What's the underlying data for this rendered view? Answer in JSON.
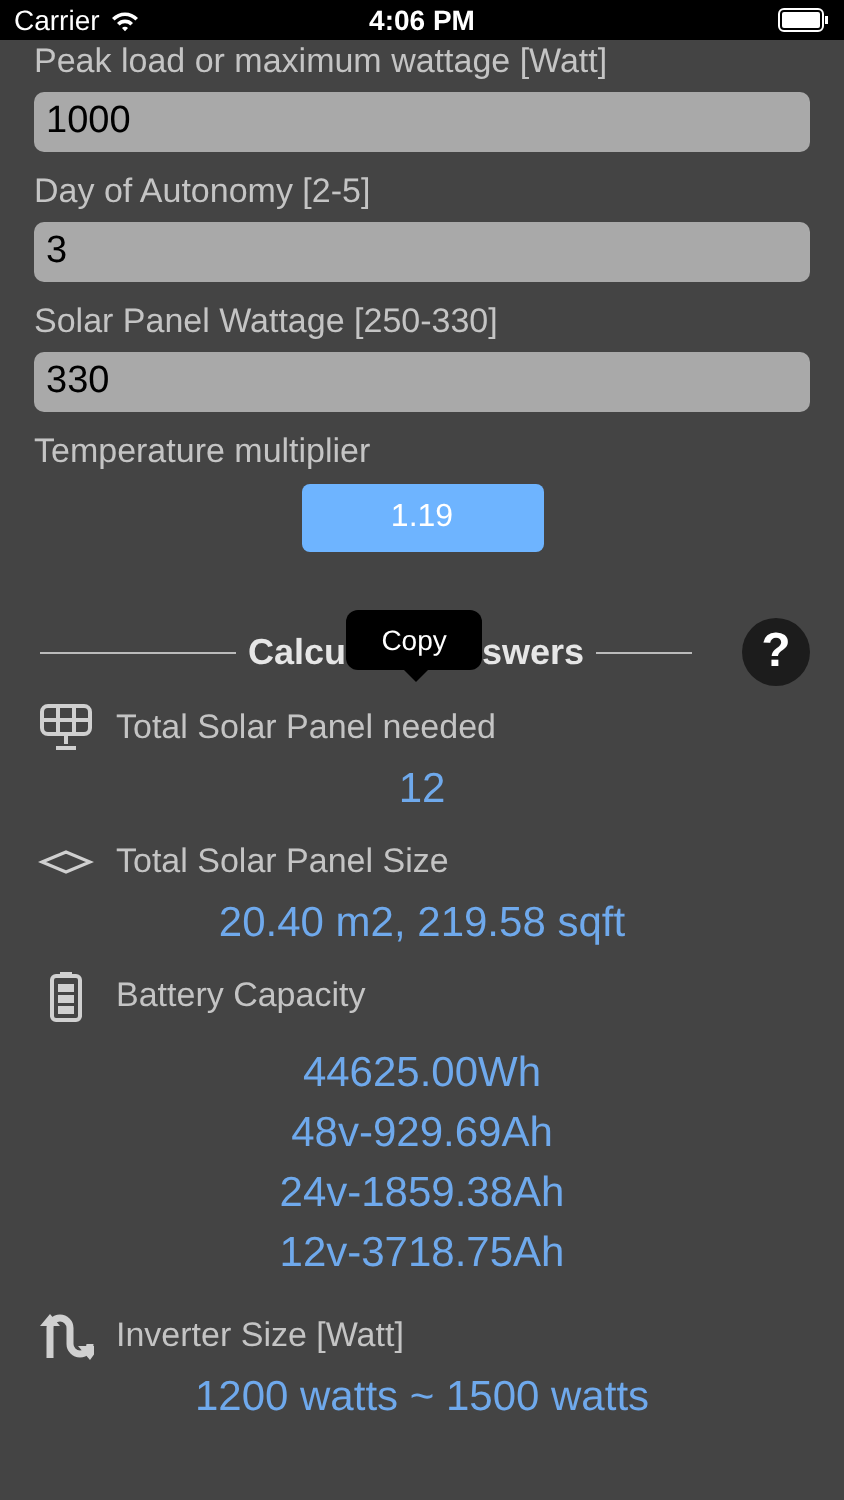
{
  "status_bar": {
    "carrier": "Carrier",
    "time": "4:06 PM"
  },
  "inputs": [
    {
      "label": "Peak load or maximum wattage [Watt]",
      "value": "1000"
    },
    {
      "label": "Day of Autonomy [2-5]",
      "value": "3"
    },
    {
      "label": "Solar Panel Wattage [250-330]",
      "value": "330"
    }
  ],
  "temperature": {
    "label": "Temperature multiplier",
    "button": "1.19"
  },
  "section": {
    "heading_start": "Calcu",
    "heading_end": "swers",
    "help": "?",
    "tooltip": "Copy"
  },
  "results": [
    {
      "kind": "panel",
      "label": "Total Solar Panel needed",
      "values": [
        "12"
      ]
    },
    {
      "kind": "size",
      "label": "Total Solar Panel Size",
      "values": [
        "20.40 m2, 219.58 sqft"
      ]
    },
    {
      "kind": "battery",
      "label": "Battery Capacity",
      "values": [
        "44625.00Wh",
        "48v-929.69Ah",
        "24v-1859.38Ah",
        "12v-3718.75Ah"
      ]
    },
    {
      "kind": "inverter",
      "label": "Inverter Size [Watt]",
      "values": [
        "1200 watts ~ 1500 watts"
      ]
    }
  ]
}
